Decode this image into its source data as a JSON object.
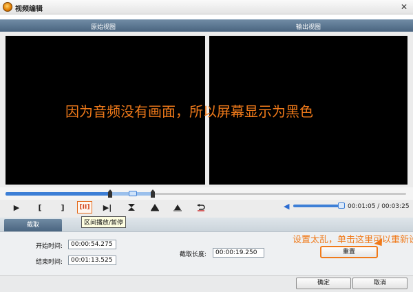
{
  "window": {
    "title": "视频编辑",
    "close_glyph": "✕"
  },
  "views": {
    "original_label": "原始视图",
    "output_label": "输出视图"
  },
  "overlay_text": "因为音频没有画面，所以屏幕显示为黑色",
  "timeline": {
    "position_fraction": 0.32,
    "selection_start_fraction": 0.265,
    "selection_end_fraction": 0.37
  },
  "controls": {
    "play": "▶",
    "mark_in": "[",
    "mark_out": "]",
    "play_range": "[II]",
    "goto_end": "▶|",
    "icons": [
      "play-icon",
      "mark-in-icon",
      "mark-out-icon",
      "play-range-icon",
      "next-frame-icon",
      "trim-icon",
      "eject-left-icon",
      "eject-right-icon",
      "undo-icon"
    ]
  },
  "volume": {
    "level_fraction": 0.9
  },
  "time": {
    "current": "00:01:05",
    "total": "00:03:25",
    "separator": " / "
  },
  "tab": {
    "label": "截取"
  },
  "tooltip": "区间播放/暂停",
  "form": {
    "start_label": "开始时间:",
    "start_value": "00:00:54.275",
    "end_label": "结束时间:",
    "end_value": "00:01:13.525",
    "length_label": "截取长度:",
    "length_value": "00:00:19.250"
  },
  "hint": "设置太乱，单击这里可以重新设置",
  "reset_label": "重置",
  "footer": {
    "ok": "确定",
    "cancel": "取消"
  },
  "colors": {
    "accent": "#f07a1a",
    "header": "#4a6580",
    "progress": "#3d7fd6"
  }
}
